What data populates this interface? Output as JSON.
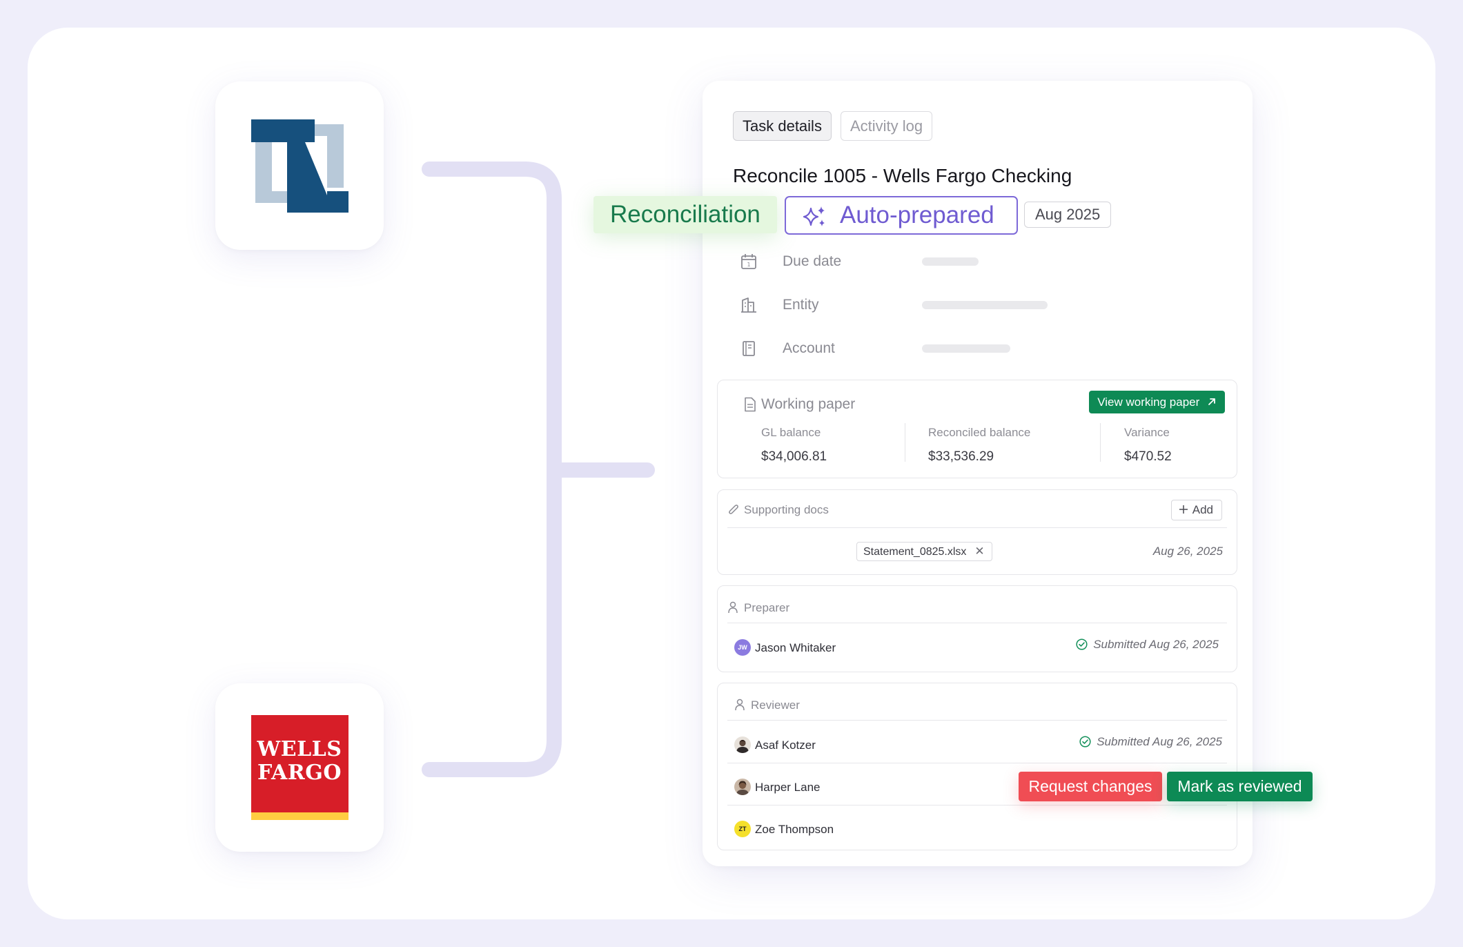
{
  "tabs": {
    "task_details": "Task details",
    "activity_log": "Activity log"
  },
  "task": {
    "title": "Reconcile 1005 - Wells Fargo Checking",
    "type_badge": "Reconciliation",
    "auto_badge": "Auto-prepared",
    "period": "Aug 2025"
  },
  "meta": {
    "due_date_label": "Due date",
    "entity_label": "Entity",
    "account_label": "Account"
  },
  "working_paper": {
    "title": "Working paper",
    "view_button": "View working paper",
    "gl_balance_label": "GL balance",
    "gl_balance_value": "$34,006.81",
    "reconciled_label": "Reconciled balance",
    "reconciled_value": "$33,536.29",
    "variance_label": "Variance",
    "variance_value": "$470.52"
  },
  "supporting_docs": {
    "title": "Supporting docs",
    "add_button": "Add",
    "file_name": "Statement_0825.xlsx",
    "file_date": "Aug 26, 2025"
  },
  "preparer": {
    "title": "Preparer",
    "name": "Jason Whitaker",
    "initials": "JW",
    "status": "Submitted Aug 26, 2025"
  },
  "reviewer": {
    "title": "Reviewer",
    "people": [
      {
        "name": "Asaf Kotzer",
        "status": "Submitted Aug 26, 2025"
      },
      {
        "name": "Harper Lane"
      },
      {
        "name": "Zoe Thompson",
        "initials": "ZT"
      }
    ],
    "request_changes": "Request changes",
    "mark_reviewed": "Mark as reviewed"
  },
  "logos": {
    "wells_fargo_line1": "WELLS",
    "wells_fargo_line2": "FARGO"
  },
  "colors": {
    "accent_green": "#0e8a55",
    "accent_purple": "#7d69d8",
    "danger": "#f04d54",
    "netsuite_dark": "#16507d",
    "netsuite_light": "#b8c9d9",
    "wells_red": "#d71e28",
    "wells_yellow": "#ffcd41"
  }
}
